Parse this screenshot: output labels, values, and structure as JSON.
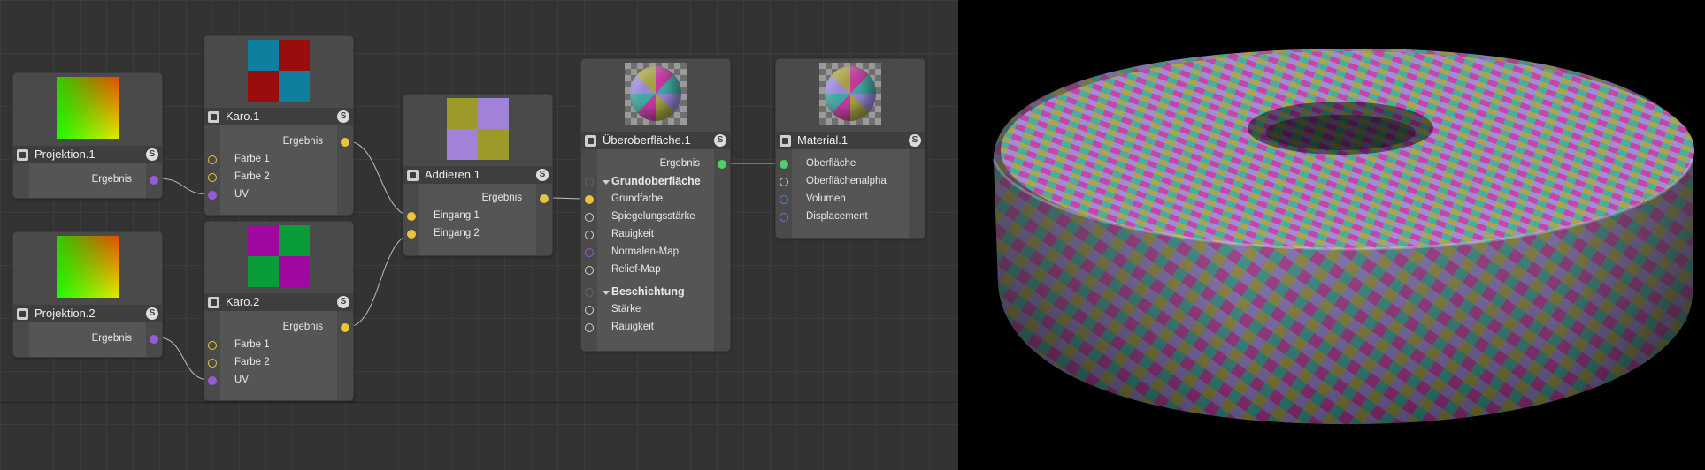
{
  "nodes": {
    "projektion1": {
      "title": "Projektion.1",
      "badge": "S",
      "outputs": [
        "Ergebnis"
      ]
    },
    "projektion2": {
      "title": "Projektion.2",
      "badge": "S",
      "outputs": [
        "Ergebnis"
      ]
    },
    "karo1": {
      "title": "Karo.1",
      "badge": "S",
      "outputs": [
        "Ergebnis"
      ],
      "inputs": [
        "Farbe 1",
        "Farbe 2",
        "UV"
      ],
      "colors": [
        "#0f7f9f",
        "#9b0c0c"
      ]
    },
    "karo2": {
      "title": "Karo.2",
      "badge": "S",
      "outputs": [
        "Ergebnis"
      ],
      "inputs": [
        "Farbe 1",
        "Farbe 2",
        "UV"
      ],
      "colors": [
        "#a0089f",
        "#0b9c3a"
      ]
    },
    "addieren1": {
      "title": "Addieren.1",
      "badge": "S",
      "outputs": [
        "Ergebnis"
      ],
      "inputs": [
        "Eingang 1",
        "Eingang 2"
      ],
      "colors": [
        "#a082d8",
        "#9e9a2a"
      ]
    },
    "ueberoberflaeche1": {
      "title": "Überoberfläche.1",
      "badge": "S",
      "outputs": [
        "Ergebnis"
      ],
      "group1": "Grundoberfläche",
      "group1_items": [
        "Grundfarbe",
        "Spiegelungsstärke",
        "Rauigkeit",
        "Normalen-Map",
        "Relief-Map"
      ],
      "group2": "Beschichtung",
      "group2_items": [
        "Stärke",
        "Rauigkeit"
      ]
    },
    "material1": {
      "title": "Material.1",
      "badge": "S",
      "inputs": [
        "Oberfläche",
        "Oberflächenalpha",
        "Volumen",
        "Displacement"
      ]
    }
  },
  "icons": {
    "node_icon": "node-type-icon",
    "solo_badge": "solo-badge"
  },
  "wire_color": "#bdbdbd",
  "checker_colors": [
    "#c33aa0",
    "#3ea8a0",
    "#9a86d8",
    "#a6a045"
  ]
}
